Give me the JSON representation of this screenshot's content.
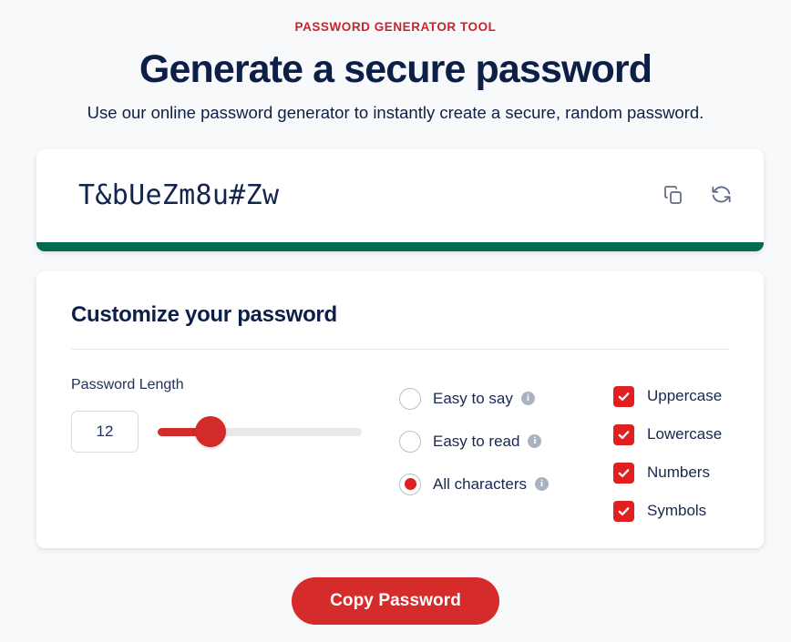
{
  "header": {
    "eyebrow": "PASSWORD GENERATOR TOOL",
    "title": "Generate a secure password",
    "subtitle": "Use our online password generator to instantly create a secure, random password."
  },
  "password_display": {
    "value": "T&bUeZm8u#Zw",
    "copy_icon": "copy-icon",
    "refresh_icon": "refresh-icon",
    "strength_color": "#006b4f",
    "strength_level": "strong"
  },
  "customize": {
    "title": "Customize your password",
    "length": {
      "label": "Password Length",
      "value": "12",
      "min": 4,
      "max": 50,
      "percent": 26
    },
    "charset_options": [
      {
        "label": "Easy to say",
        "selected": false,
        "info": "i"
      },
      {
        "label": "Easy to read",
        "selected": false,
        "info": "i"
      },
      {
        "label": "All characters",
        "selected": true,
        "info": "i"
      }
    ],
    "include_options": [
      {
        "label": "Uppercase",
        "checked": true
      },
      {
        "label": "Lowercase",
        "checked": true
      },
      {
        "label": "Numbers",
        "checked": true
      },
      {
        "label": "Symbols",
        "checked": true
      }
    ]
  },
  "cta": {
    "label": "Copy Password"
  },
  "colors": {
    "brand_red": "#d52b2b",
    "accent_red": "#e02020",
    "navy": "#0d1f47",
    "green": "#006b4f",
    "page_bg": "#f7f9fb"
  }
}
